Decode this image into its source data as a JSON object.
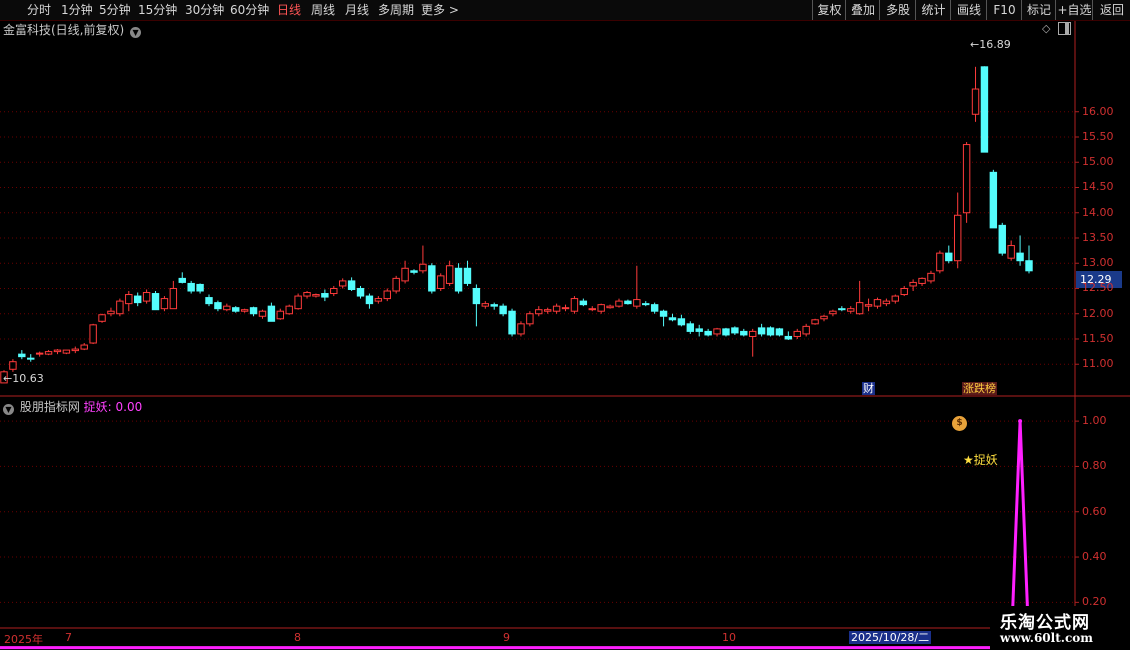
{
  "toolbar": {
    "periods": [
      "分时",
      "1分钟",
      "5分钟",
      "15分钟",
      "30分钟",
      "60分钟",
      "日线",
      "周线",
      "月线",
      "多周期",
      "更多 >"
    ],
    "active_period": "日线",
    "right_buttons": [
      "复权",
      "叠加",
      "多股",
      "统计",
      "画线",
      "F10",
      "标记",
      "+自选",
      "返回"
    ]
  },
  "main_panel": {
    "title": "金富科技(日线,前复权)",
    "current_price": "12.29",
    "high_marker": "16.89",
    "low_marker": "10.63",
    "badge_cai": "财",
    "badge_zdb": "涨跌榜"
  },
  "sub_panel": {
    "indicator_name": "股朋指标网",
    "series_label": "捉妖: 0.00",
    "signal_text": "捉妖"
  },
  "xaxis": {
    "year_label": "2025年",
    "months": [
      "7",
      "8",
      "9",
      "10"
    ],
    "current_date": "2025/10/28/二"
  },
  "logo": {
    "name": "乐淘公式网",
    "url": "www.60lt.com"
  },
  "colors": {
    "up": "#ff3b3b",
    "down": "#54fcfc",
    "grid": "#6a0000",
    "indicator": "#ff20ff"
  },
  "chart_data": [
    {
      "type": "candlestick",
      "title": "金富科技(日线,前复权)",
      "ylim": [
        10.45,
        17.5
      ],
      "yticks": [
        11.0,
        11.5,
        12.0,
        12.5,
        13.0,
        13.5,
        14.0,
        14.5,
        15.0,
        15.5,
        16.0
      ],
      "ohlc": [
        [
          10.63,
          10.88,
          10.63,
          10.85
        ],
        [
          10.9,
          11.1,
          10.85,
          11.05
        ],
        [
          11.2,
          11.28,
          11.1,
          11.15
        ],
        [
          11.12,
          11.2,
          11.05,
          11.1
        ],
        [
          11.2,
          11.25,
          11.15,
          11.22
        ],
        [
          11.2,
          11.28,
          11.18,
          11.25
        ],
        [
          11.25,
          11.3,
          11.2,
          11.28
        ],
        [
          11.22,
          11.28,
          11.2,
          11.28
        ],
        [
          11.27,
          11.35,
          11.22,
          11.3
        ],
        [
          11.3,
          11.42,
          11.28,
          11.38
        ],
        [
          11.42,
          11.8,
          11.4,
          11.78
        ],
        [
          11.85,
          12.0,
          11.82,
          11.98
        ],
        [
          12.0,
          12.12,
          11.95,
          12.05
        ],
        [
          12.0,
          12.3,
          11.95,
          12.25
        ],
        [
          12.2,
          12.45,
          12.05,
          12.38
        ],
        [
          12.35,
          12.42,
          12.15,
          12.22
        ],
        [
          12.25,
          12.48,
          12.2,
          12.42
        ],
        [
          12.4,
          12.45,
          12.1,
          12.08
        ],
        [
          12.1,
          12.35,
          12.05,
          12.3
        ],
        [
          12.1,
          12.65,
          12.1,
          12.5
        ],
        [
          12.7,
          12.82,
          12.6,
          12.62
        ],
        [
          12.6,
          12.65,
          12.4,
          12.45
        ],
        [
          12.58,
          12.6,
          12.4,
          12.45
        ],
        [
          12.32,
          12.38,
          12.15,
          12.2
        ],
        [
          12.22,
          12.26,
          12.05,
          12.1
        ],
        [
          12.08,
          12.2,
          12.05,
          12.15
        ],
        [
          12.12,
          12.15,
          12.02,
          12.05
        ],
        [
          12.05,
          12.1,
          12.02,
          12.08
        ],
        [
          12.12,
          12.14,
          11.95,
          12.0
        ],
        [
          11.95,
          12.08,
          11.9,
          12.05
        ],
        [
          12.15,
          12.22,
          11.85,
          11.85
        ],
        [
          11.9,
          12.1,
          11.88,
          12.05
        ],
        [
          12.0,
          12.18,
          11.98,
          12.15
        ],
        [
          12.1,
          12.4,
          12.08,
          12.35
        ],
        [
          12.35,
          12.45,
          12.3,
          12.42
        ],
        [
          12.35,
          12.4,
          12.32,
          12.38
        ],
        [
          12.4,
          12.48,
          12.25,
          12.33
        ],
        [
          12.4,
          12.55,
          12.35,
          12.5
        ],
        [
          12.55,
          12.7,
          12.5,
          12.65
        ],
        [
          12.65,
          12.72,
          12.45,
          12.48
        ],
        [
          12.5,
          12.55,
          12.3,
          12.35
        ],
        [
          12.35,
          12.4,
          12.1,
          12.2
        ],
        [
          12.25,
          12.35,
          12.2,
          12.3
        ],
        [
          12.3,
          12.5,
          12.25,
          12.45
        ],
        [
          12.45,
          12.75,
          12.4,
          12.7
        ],
        [
          12.65,
          13.05,
          12.6,
          12.9
        ],
        [
          12.85,
          12.88,
          12.78,
          12.82
        ],
        [
          12.85,
          13.35,
          12.8,
          12.98
        ],
        [
          12.95,
          13.0,
          12.4,
          12.45
        ],
        [
          12.5,
          12.8,
          12.45,
          12.75
        ],
        [
          12.6,
          13.05,
          12.55,
          12.95
        ],
        [
          12.9,
          13.0,
          12.4,
          12.45
        ],
        [
          12.9,
          13.05,
          12.55,
          12.6
        ],
        [
          12.5,
          12.58,
          11.75,
          12.2
        ],
        [
          12.15,
          12.25,
          12.1,
          12.2
        ],
        [
          12.18,
          12.22,
          12.08,
          12.15
        ],
        [
          12.15,
          12.2,
          11.95,
          12.0
        ],
        [
          12.05,
          12.1,
          11.55,
          11.6
        ],
        [
          11.6,
          11.85,
          11.55,
          11.8
        ],
        [
          11.8,
          12.05,
          11.75,
          12.0
        ],
        [
          12.0,
          12.15,
          11.95,
          12.08
        ],
        [
          12.05,
          12.12,
          12.0,
          12.08
        ],
        [
          12.05,
          12.2,
          12.0,
          12.15
        ],
        [
          12.1,
          12.18,
          12.05,
          12.12
        ],
        [
          12.05,
          12.35,
          12.0,
          12.3
        ],
        [
          12.25,
          12.3,
          12.15,
          12.18
        ],
        [
          12.1,
          12.15,
          12.05,
          12.1
        ],
        [
          12.05,
          12.2,
          12.0,
          12.18
        ],
        [
          12.12,
          12.18,
          12.1,
          12.15
        ],
        [
          12.15,
          12.3,
          12.12,
          12.25
        ],
        [
          12.25,
          12.28,
          12.18,
          12.2
        ],
        [
          12.15,
          12.95,
          12.1,
          12.28
        ],
        [
          12.2,
          12.25,
          12.15,
          12.18
        ],
        [
          12.18,
          12.22,
          12.0,
          12.05
        ],
        [
          12.05,
          12.08,
          11.75,
          11.95
        ],
        [
          11.92,
          12.0,
          11.85,
          11.88
        ],
        [
          11.9,
          11.98,
          11.75,
          11.78
        ],
        [
          11.8,
          11.85,
          11.6,
          11.65
        ],
        [
          11.7,
          11.78,
          11.55,
          11.65
        ],
        [
          11.65,
          11.7,
          11.55,
          11.58
        ],
        [
          11.6,
          11.72,
          11.55,
          11.7
        ],
        [
          11.7,
          11.72,
          11.55,
          11.58
        ],
        [
          11.72,
          11.75,
          11.58,
          11.62
        ],
        [
          11.65,
          11.7,
          11.55,
          11.58
        ],
        [
          11.55,
          11.7,
          11.15,
          11.65
        ],
        [
          11.72,
          11.8,
          11.55,
          11.6
        ],
        [
          11.72,
          11.75,
          11.55,
          11.58
        ],
        [
          11.7,
          11.72,
          11.55,
          11.58
        ],
        [
          11.55,
          11.65,
          11.48,
          11.5
        ],
        [
          11.55,
          11.7,
          11.5,
          11.65
        ],
        [
          11.6,
          11.8,
          11.55,
          11.75
        ],
        [
          11.8,
          11.9,
          11.78,
          11.88
        ],
        [
          11.9,
          11.98,
          11.85,
          11.95
        ],
        [
          12.0,
          12.08,
          11.95,
          12.05
        ],
        [
          12.1,
          12.15,
          12.05,
          12.08
        ],
        [
          12.05,
          12.15,
          12.0,
          12.1
        ],
        [
          12.0,
          12.65,
          11.98,
          12.22
        ],
        [
          12.15,
          12.3,
          12.05,
          12.18
        ],
        [
          12.15,
          12.32,
          12.1,
          12.28
        ],
        [
          12.2,
          12.3,
          12.15,
          12.25
        ],
        [
          12.25,
          12.38,
          12.2,
          12.35
        ],
        [
          12.38,
          12.55,
          12.35,
          12.5
        ],
        [
          12.55,
          12.68,
          12.45,
          12.62
        ],
        [
          12.6,
          12.72,
          12.55,
          12.7
        ],
        [
          12.65,
          12.85,
          12.6,
          12.8
        ],
        [
          12.85,
          13.25,
          12.8,
          13.2
        ],
        [
          13.2,
          13.35,
          13.0,
          13.05
        ],
        [
          13.05,
          14.4,
          12.9,
          13.95
        ],
        [
          14.0,
          15.4,
          13.8,
          15.35
        ],
        [
          15.95,
          16.89,
          15.8,
          16.45
        ],
        [
          16.89,
          16.9,
          15.2,
          15.2
        ],
        [
          14.8,
          14.85,
          13.7,
          13.7
        ],
        [
          13.75,
          13.8,
          13.15,
          13.2
        ],
        [
          13.1,
          13.45,
          13.05,
          13.35
        ],
        [
          13.2,
          13.55,
          12.95,
          13.05
        ],
        [
          13.05,
          13.35,
          12.8,
          12.85
        ]
      ]
    },
    {
      "type": "line",
      "series": [
        {
          "name": "捉妖",
          "values": [
            0,
            0,
            0,
            0,
            0,
            0,
            0,
            0,
            0,
            0,
            0,
            0,
            0,
            0,
            0,
            0,
            0,
            0,
            0,
            0,
            0,
            0,
            0,
            0,
            0,
            0,
            0,
            0,
            0,
            0,
            0,
            0,
            0,
            0,
            0,
            0,
            0,
            0,
            0,
            0,
            0,
            0,
            0,
            0,
            0,
            0,
            0,
            0,
            0,
            0,
            0,
            0,
            0,
            0,
            0,
            0,
            0,
            0,
            0,
            0,
            0,
            0,
            0,
            0,
            0,
            0,
            0,
            0,
            0,
            0,
            0,
            0,
            0,
            0,
            0,
            0,
            0,
            0,
            0,
            0,
            0,
            0,
            0,
            0,
            0,
            0,
            0,
            0,
            0,
            0,
            0,
            0,
            0,
            0,
            0,
            0,
            0,
            0,
            0,
            0,
            0,
            0,
            0,
            0,
            0,
            0,
            0,
            0,
            0,
            0,
            0,
            0,
            0,
            0,
            1,
            0,
            0,
            0,
            0,
            0,
            0,
            0
          ]
        }
      ],
      "ylim": [
        0.1,
        1.08
      ],
      "yticks": [
        0.2,
        0.4,
        0.6,
        0.8,
        1.0
      ]
    }
  ]
}
